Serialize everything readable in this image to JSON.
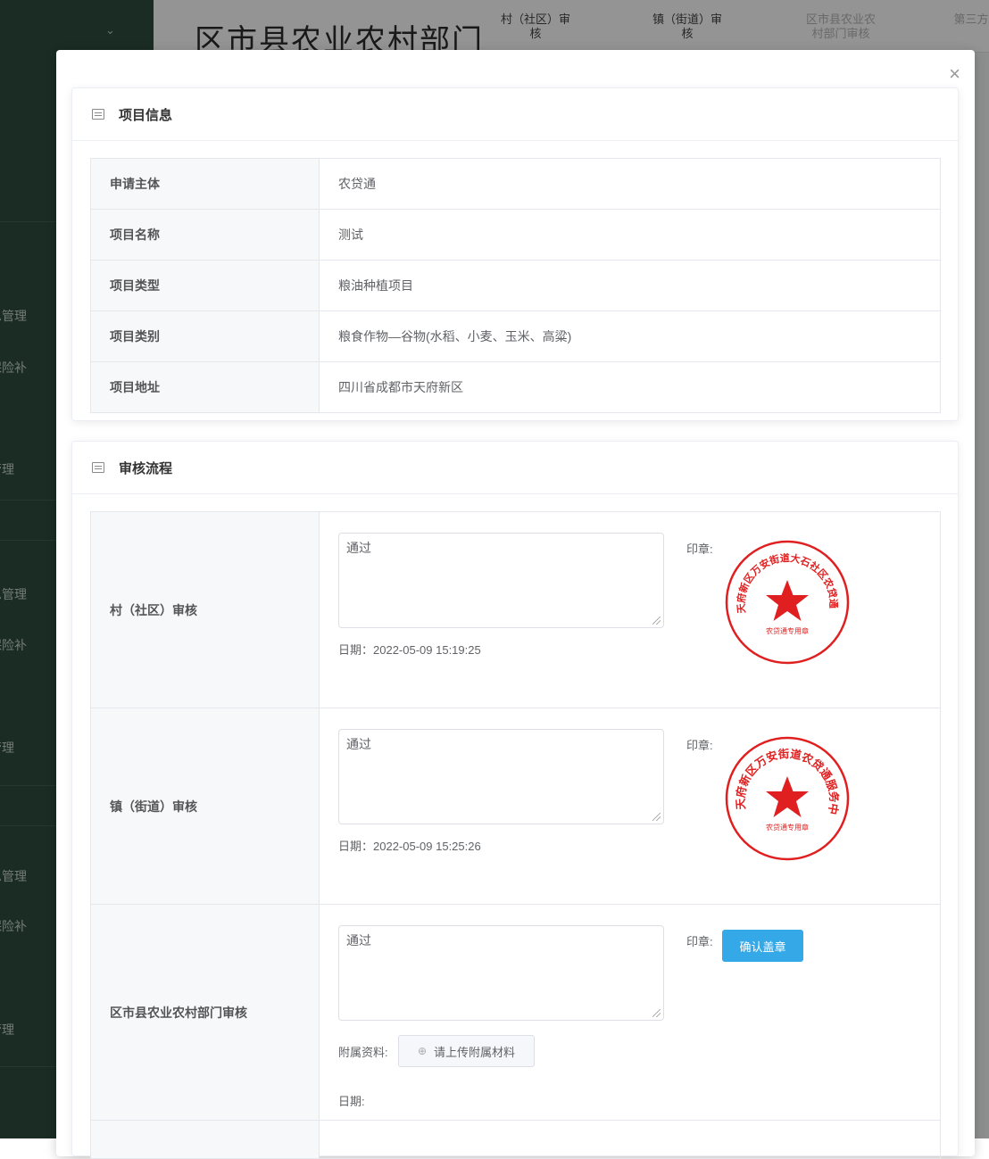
{
  "background": {
    "page_title": "区市县农业农村部门",
    "columns": [
      {
        "label": "村（社区）审核"
      },
      {
        "label": "镇（街道）审核"
      },
      {
        "label": "区市县农业农村部门审核"
      },
      {
        "label": "第三方"
      }
    ],
    "sidebar_items": [
      "息管理",
      "保险补",
      "管理",
      "息管理",
      "保险补",
      "管理",
      "息管理",
      "保险补",
      "管理"
    ]
  },
  "modal": {
    "close_glyph": "×",
    "project_info": {
      "title": "项目信息",
      "rows": [
        {
          "label": "申请主体",
          "value": "农贷通"
        },
        {
          "label": "项目名称",
          "value": "测试"
        },
        {
          "label": "项目类型",
          "value": "粮油种植项目"
        },
        {
          "label": "项目类别",
          "value": "粮食作物—谷物(水稻、小麦、玉米、高粱)"
        },
        {
          "label": "项目地址",
          "value": "四川省成都市天府新区"
        }
      ]
    },
    "review_flow": {
      "title": "审核流程",
      "seal_label": "印章:",
      "rows": [
        {
          "label": "村（社区）审核",
          "opinion": "通过",
          "date": "日期：2022-05-09 15:19:25",
          "seal_text": "天府新区万安街道大石社区农贷通服务站",
          "seal_bottom": "农贷通专用章"
        },
        {
          "label": "镇（街道）审核",
          "opinion": "通过",
          "date": "日期：2022-05-09 15:25:26",
          "seal_text": "天府新区万安街道农贷通服务中心",
          "seal_bottom": "农贷通专用章"
        },
        {
          "label": "区市县农业农村部门审核",
          "opinion": "通过",
          "confirm_button": "确认盖章",
          "attachment_label": "附属资料:",
          "upload_button": "请上传附属材料",
          "date": "日期:"
        }
      ]
    }
  },
  "colors": {
    "sidebar": "#2e4d3f",
    "seal_red": "#e02020",
    "primary_button": "#35a9e8"
  }
}
